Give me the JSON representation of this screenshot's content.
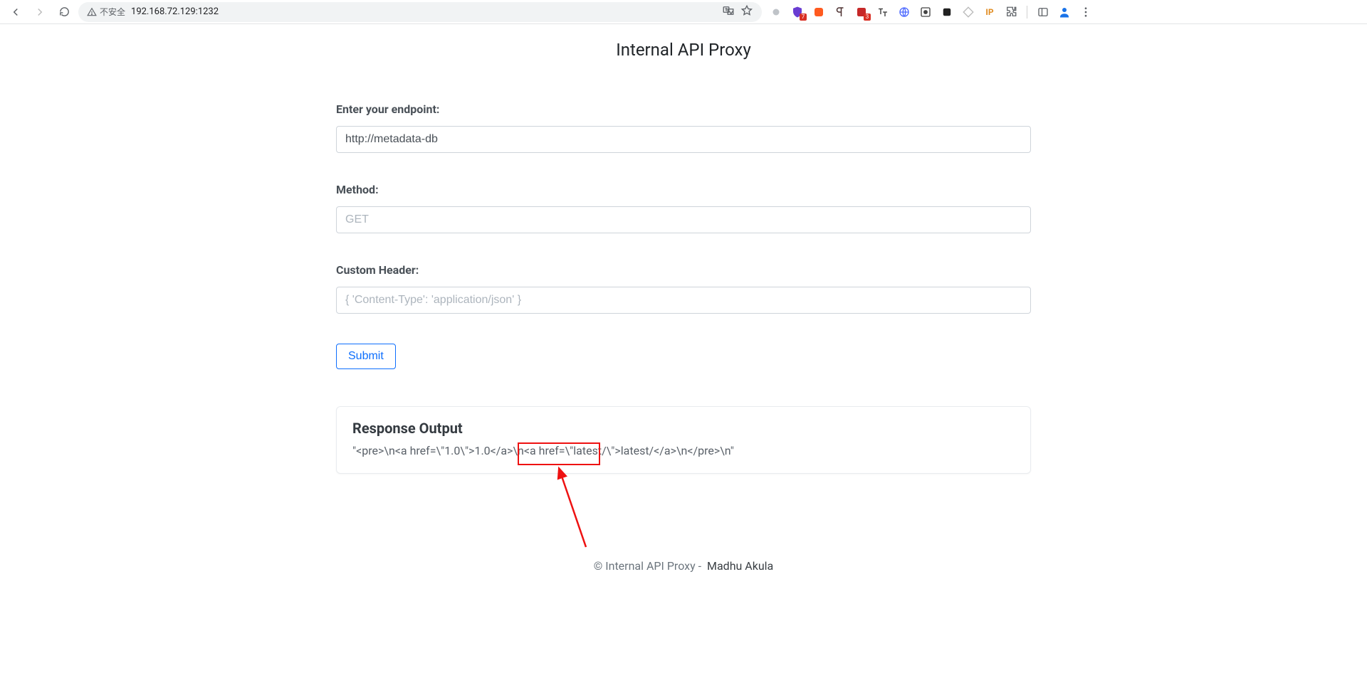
{
  "chrome": {
    "url": "192.168.72.129:1232",
    "not_secure_label": "不安全"
  },
  "page": {
    "title": "Internal API Proxy"
  },
  "form": {
    "endpoint_label": "Enter your endpoint:",
    "endpoint_value": "http://metadata-db",
    "method_label": "Method:",
    "method_placeholder": "GET",
    "header_label": "Custom Header:",
    "header_placeholder": "{ 'Content-Type': 'application/json' }",
    "submit_label": "Submit"
  },
  "response": {
    "title": "Response Output",
    "body": "\"<pre>\\n<a href=\\\"1.0\\\">1.0</a>\\n<a href=\\\"latest/\\\">latest/</a>\\n</pre>\\n\""
  },
  "footer": {
    "prefix": "© Internal API Proxy -",
    "author": "Madhu Akula"
  }
}
